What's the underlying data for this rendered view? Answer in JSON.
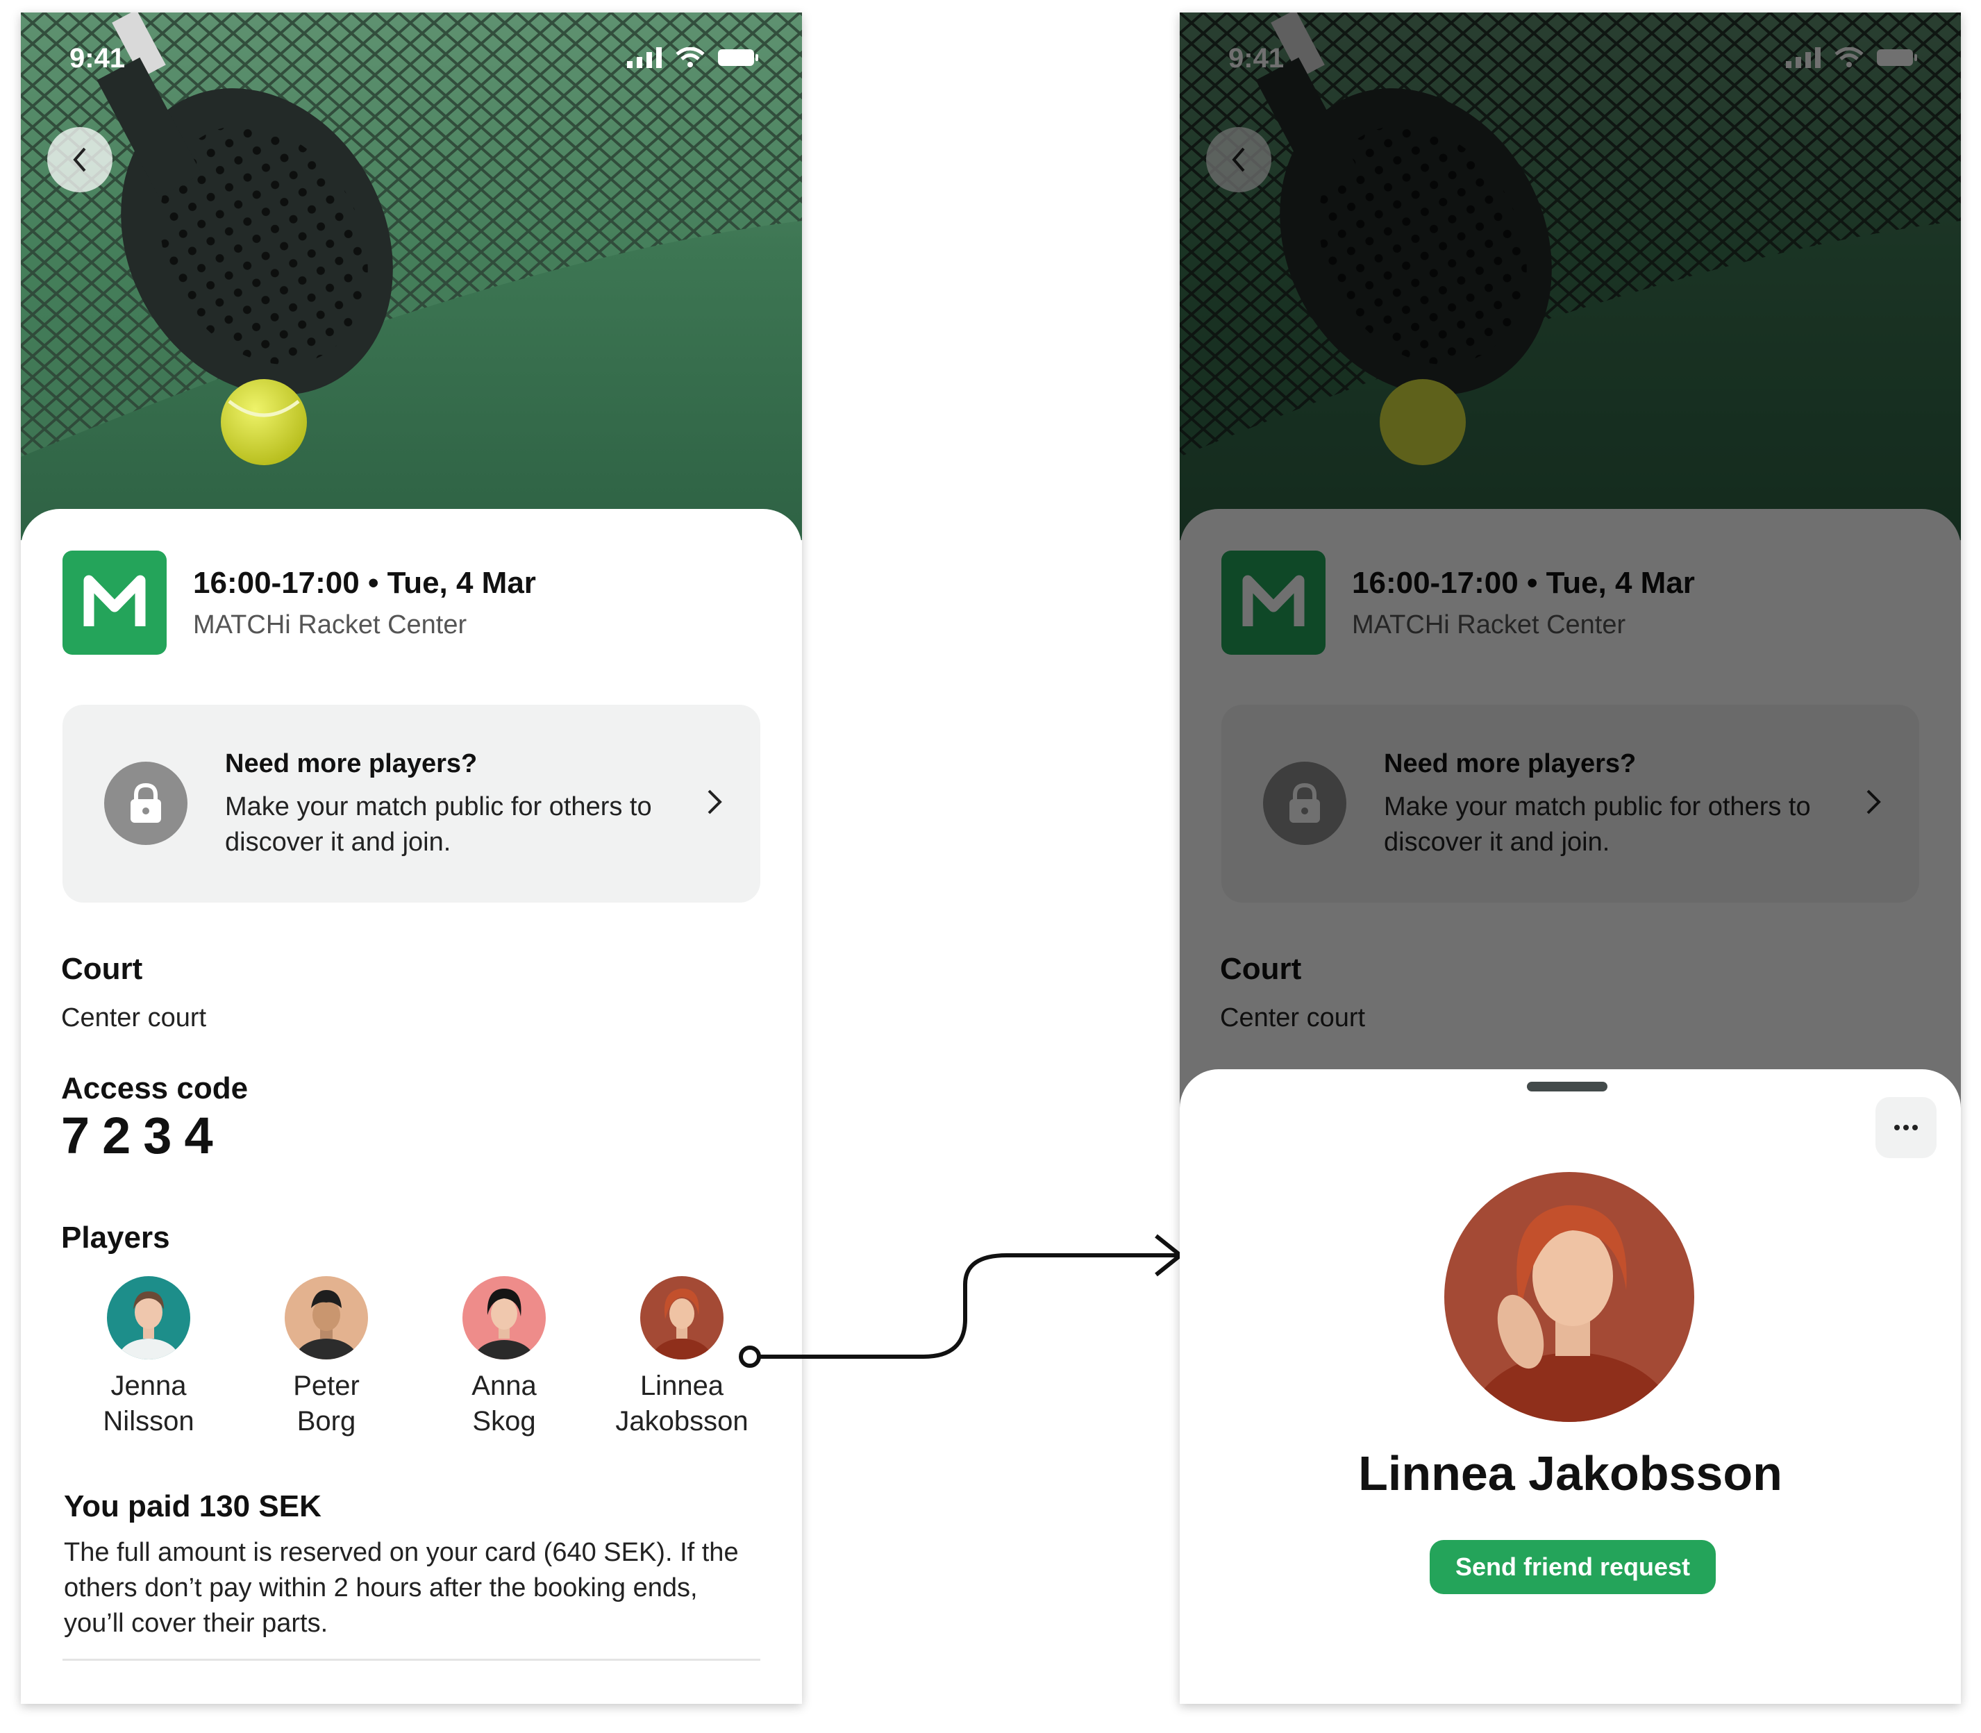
{
  "colors": {
    "brand_green": "#24a45a",
    "promo_bg": "#f1f2f2",
    "lock_grey": "#8d8d8d"
  },
  "status_bar": {
    "time": "9:41"
  },
  "booking": {
    "venue_logo_letter": "M",
    "time": "16:00-17:00 • Tue, 4 Mar",
    "venue": "MATCHi Racket Center"
  },
  "promo": {
    "title": "Need more players?",
    "body": "Make your match public for others to discover it and join."
  },
  "court": {
    "label": "Court",
    "value": "Center court"
  },
  "access": {
    "label": "Access code",
    "code": "7234"
  },
  "players": {
    "label": "Players",
    "items": [
      {
        "first": "Jenna",
        "last": "Nilsson"
      },
      {
        "first": "Peter",
        "last": "Borg"
      },
      {
        "first": "Anna",
        "last": "Skog"
      },
      {
        "first": "Linnea",
        "last": "Jakobsson"
      }
    ]
  },
  "payment": {
    "title": "You paid 130 SEK",
    "body": "The full amount is reserved on your card (640 SEK). If the others don’t pay within 2 hours after the booking ends, you’ll cover their parts."
  },
  "profile_modal": {
    "name": "Linnea Jakobsson",
    "more_icon": "more-icon",
    "action": "Send friend request"
  }
}
